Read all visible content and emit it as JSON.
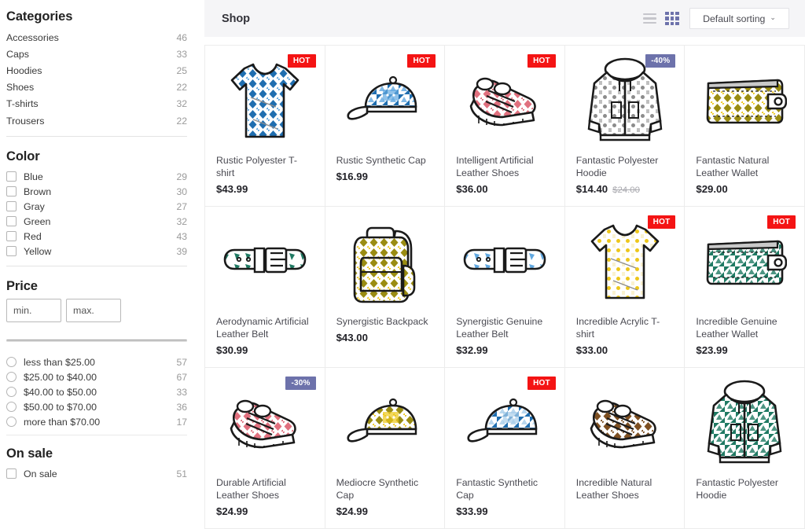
{
  "sidebar": {
    "categories": {
      "title": "Categories",
      "items": [
        {
          "label": "Accessories",
          "count": "46"
        },
        {
          "label": "Caps",
          "count": "33"
        },
        {
          "label": "Hoodies",
          "count": "25"
        },
        {
          "label": "Shoes",
          "count": "22"
        },
        {
          "label": "T-shirts",
          "count": "32"
        },
        {
          "label": "Trousers",
          "count": "22"
        }
      ]
    },
    "color": {
      "title": "Color",
      "items": [
        {
          "label": "Blue",
          "count": "29"
        },
        {
          "label": "Brown",
          "count": "30"
        },
        {
          "label": "Gray",
          "count": "27"
        },
        {
          "label": "Green",
          "count": "32"
        },
        {
          "label": "Red",
          "count": "43"
        },
        {
          "label": "Yellow",
          "count": "39"
        }
      ]
    },
    "price": {
      "title": "Price",
      "min_placeholder": "min.",
      "max_placeholder": "max.",
      "min_value": "",
      "max_value": "",
      "ranges": [
        {
          "label": "less than $25.00",
          "count": "57"
        },
        {
          "label": "$25.00 to $40.00",
          "count": "67"
        },
        {
          "label": "$40.00 to $50.00",
          "count": "33"
        },
        {
          "label": "$50.00 to $70.00",
          "count": "36"
        },
        {
          "label": "more than $70.00",
          "count": "17"
        }
      ]
    },
    "on_sale": {
      "title": "On sale",
      "items": [
        {
          "label": "On sale",
          "count": "51"
        }
      ]
    }
  },
  "header": {
    "title": "Shop",
    "list_view_icon": "list-icon",
    "grid_view_icon": "grid-icon",
    "grid_view_active": true,
    "sort_label": "Default sorting",
    "sort_chevron": "⌄",
    "accent_active": "#6d72ab",
    "accent_inactive": "#c6c6cc"
  },
  "colors": {
    "hot_badge": "#f41414",
    "sale_badge": "#6d72ab",
    "blue": "#1f6eb0",
    "lightblue": "#61a8e0",
    "yellow": "#edc71a",
    "olive": "#9a8c12",
    "gray": "#8c8c8c",
    "green": "#1f7a63",
    "red": "#e0707e",
    "brown": "#7d4f21"
  },
  "products": [
    {
      "name": "Rustic Polyester T-shirt",
      "price": "$43.99",
      "old_price": "",
      "badge": "HOT",
      "badge_type": "hot",
      "icon": "tshirt-icon",
      "color": "#1f6eb0",
      "accent": "#61a8e0"
    },
    {
      "name": "Rustic Synthetic Cap",
      "price": "$16.99",
      "old_price": "",
      "badge": "HOT",
      "badge_type": "hot",
      "icon": "cap-icon",
      "color": "#1f6eb0",
      "accent": "#61a8e0"
    },
    {
      "name": "Intelligent Artificial Leather Shoes",
      "price": "$36.00",
      "old_price": "",
      "badge": "HOT",
      "badge_type": "hot",
      "icon": "shoes-icon",
      "color": "#e0707e",
      "accent": "#e0707e"
    },
    {
      "name": "Fantastic Polyester Hoodie",
      "price": "$14.40",
      "old_price": "$24.00",
      "badge": "-40%",
      "badge_type": "sale",
      "icon": "hoodie-icon",
      "color": "#8c8c8c",
      "accent": "#8c8c8c"
    },
    {
      "name": "Fantastic Natural Leather Wallet",
      "price": "$29.00",
      "old_price": "",
      "badge": "",
      "badge_type": "",
      "icon": "wallet-icon",
      "color": "#9a8c12",
      "accent": "#edc71a"
    },
    {
      "name": "Aerodynamic Artificial Leather Belt",
      "price": "$30.99",
      "old_price": "",
      "badge": "",
      "badge_type": "",
      "icon": "belt-icon",
      "color": "#1f7a63",
      "accent": "#1f7a63"
    },
    {
      "name": "Synergistic Backpack",
      "price": "$43.00",
      "old_price": "",
      "badge": "",
      "badge_type": "",
      "icon": "backpack-icon",
      "color": "#9a8c12",
      "accent": "#edc71a"
    },
    {
      "name": "Synergistic Genuine Leather Belt",
      "price": "$32.99",
      "old_price": "",
      "badge": "",
      "badge_type": "",
      "icon": "belt-icon",
      "color": "#61a8e0",
      "accent": "#61a8e0"
    },
    {
      "name": "Incredible Acrylic T-shirt",
      "price": "$33.00",
      "old_price": "",
      "badge": "HOT",
      "badge_type": "hot",
      "icon": "tshirt-icon",
      "color": "#edc71a",
      "accent": "#f5e7a8"
    },
    {
      "name": "Incredible Genuine Leather Wallet",
      "price": "$23.99",
      "old_price": "",
      "badge": "HOT",
      "badge_type": "hot",
      "icon": "wallet-icon",
      "color": "#1f7a63",
      "accent": "#1f7a63"
    },
    {
      "name": "Durable Artificial Leather Shoes",
      "price": "$24.99",
      "old_price": "",
      "badge": "-30%",
      "badge_type": "sale",
      "icon": "shoes-icon",
      "color": "#e0707e",
      "accent": "#e0707e"
    },
    {
      "name": "Mediocre Synthetic Cap",
      "price": "$24.99",
      "old_price": "",
      "badge": "",
      "badge_type": "",
      "icon": "cap-icon",
      "color": "#9a8c12",
      "accent": "#edc71a"
    },
    {
      "name": "Fantastic Synthetic Cap",
      "price": "$33.99",
      "old_price": "",
      "badge": "HOT",
      "badge_type": "hot",
      "icon": "cap-icon",
      "color": "#1f6eb0",
      "accent": "#a8cdea"
    },
    {
      "name": "Incredible Natural Leather Shoes",
      "price": "",
      "old_price": "",
      "badge": "",
      "badge_type": "",
      "icon": "shoes-icon",
      "color": "#7d4f21",
      "accent": "#7d4f21"
    },
    {
      "name": "Fantastic Polyester Hoodie",
      "price": "",
      "old_price": "",
      "badge": "",
      "badge_type": "",
      "icon": "hoodie-icon",
      "color": "#1f7a63",
      "accent": "#1f7a63"
    }
  ]
}
